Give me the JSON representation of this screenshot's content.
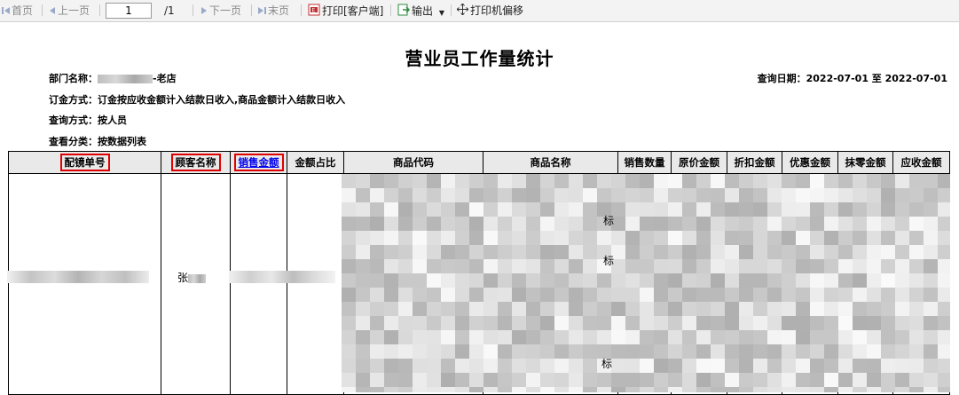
{
  "toolbar": {
    "first": "首页",
    "prev": "上一页",
    "page_value": "1",
    "page_total": "/1",
    "next": "下一页",
    "last": "末页",
    "print_client": "打印[客户端]",
    "export": "输出",
    "printer_offset": "打印机偏移"
  },
  "report": {
    "title": "营业员工作量统计",
    "dept_label": "部门名称：",
    "dept_suffix": "-老店",
    "query_date_label": "查询日期：",
    "query_date_value": "2022-07-01 至 2022-07-01",
    "order_method_label": "订金方式：",
    "order_method_value": "订金按应收金额计入结款日收入,商品金额计入结款日收入",
    "query_method_label": "查询方式：",
    "query_method_value": "按人员",
    "view_type_label": "查看分类：",
    "view_type_value": "按数据列表"
  },
  "table": {
    "columns": [
      "配镜单号",
      "顾客名称",
      "销售金额",
      "金额占比",
      "商品代码",
      "商品名称",
      "销售数量",
      "原价金额",
      "折扣金额",
      "优惠金额",
      "抹零金额",
      "应收金额"
    ],
    "customer_partial": "张",
    "fragments": [
      "标",
      "标",
      "标"
    ]
  },
  "colors": {
    "highlight": "#e00000",
    "link": "#0000ee",
    "header_bg": "#e9e9e9"
  }
}
